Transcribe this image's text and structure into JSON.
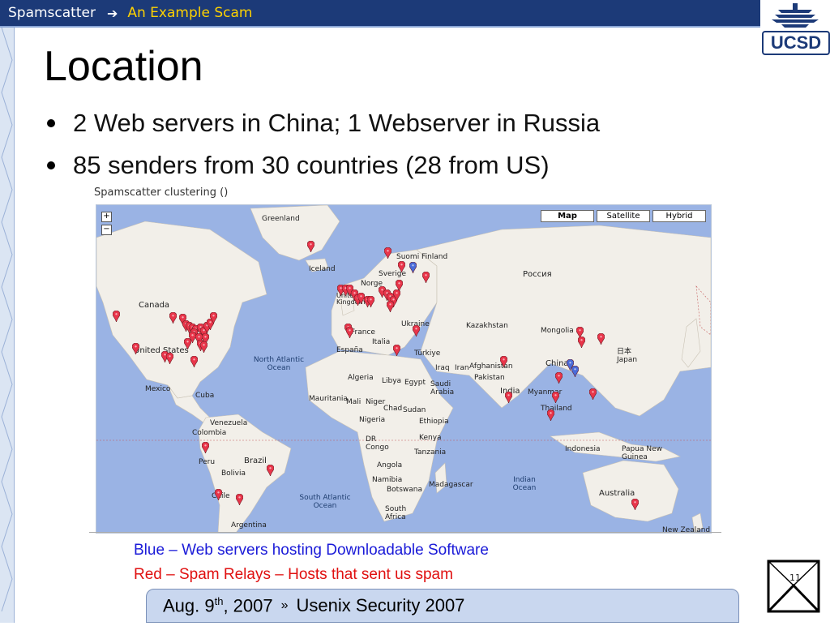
{
  "header": {
    "crumb_1": "Spamscatter",
    "crumb_2": "An Example Scam",
    "logo_text": "UCSD"
  },
  "slide": {
    "title": "Location",
    "bullets": [
      "2 Web servers in China; 1 Webserver in Russia",
      "85 senders from 30 countries (28 from US)"
    ]
  },
  "map": {
    "caption": "Spamscatter clustering ()",
    "type_buttons": [
      "Map",
      "Satellite",
      "Hybrid"
    ],
    "active_type": "Map",
    "zoom_in": "+",
    "zoom_out": "−",
    "labels": {
      "greenland": "Greenland",
      "iceland": "Iceland",
      "suomi": "Suomi Finland",
      "sverige": "Sverige",
      "norge": "Norge",
      "russia": "Россия",
      "canada": "Canada",
      "united_states": "United States",
      "mexico": "Mexico",
      "cuba": "Cuba",
      "venezuela": "Venezuela",
      "colombia": "Colombia",
      "peru": "Peru",
      "bolivia": "Bolivia",
      "brazil": "Brazil",
      "chile": "Chile",
      "argentina": "Argentina",
      "north_atlantic": "North Atlantic Ocean",
      "south_atlantic": "South Atlantic Ocean",
      "indian_ocean": "Indian Ocean",
      "france": "France",
      "espana": "España",
      "italia": "Italia",
      "ukraine": "Ukraine",
      "turkiye": "Türkiye",
      "kazakhstan": "Kazakhstan",
      "mongolia": "Mongolia",
      "china": "China",
      "japan": "日本 Japan",
      "algeria": "Algeria",
      "libya": "Libya",
      "egypt": "Egypt",
      "saudi": "Saudi Arabia",
      "iran": "Iran",
      "iraq": "Iraq",
      "afghanistan": "Afghanistan",
      "pakistan": "Pakistan",
      "india": "India",
      "myanmar": "Myanmar",
      "thailand": "Thailand",
      "mauritania": "Mauritania",
      "mali": "Mali",
      "niger": "Niger",
      "chad": "Chad",
      "sudan": "Sudan",
      "nigeria": "Nigeria",
      "ethiopia": "Ethiopia",
      "kenya": "Kenya",
      "dr_congo": "DR Congo",
      "tanzania": "Tanzania",
      "angola": "Angola",
      "namibia": "Namibia",
      "botswana": "Botswana",
      "south_africa": "South Africa",
      "madagascar": "Madagascar",
      "indonesia": "Indonesia",
      "papua": "Papua New Guinea",
      "australia": "Australia",
      "new_zealand": "New Zealand",
      "united_kingdom": "United Kingdom"
    }
  },
  "legend": {
    "blue": "Blue – Web servers hosting Downloadable Software",
    "red": "Red – Spam Relays – Hosts that sent us spam"
  },
  "footer": {
    "date_main": "Aug. 9",
    "date_sup": "th",
    "date_year": ", 2007",
    "separator": "»",
    "venue": "Usenix Security 2007"
  },
  "slide_number": "11",
  "colors": {
    "header_bg": "#1c3a78",
    "crumb_accent": "#ffd200",
    "ocean": "#9ab3e4",
    "land": "#f2efe9",
    "pin_red": "#e8354a",
    "pin_blue": "#4a6bd8",
    "legend_blue": "#1a1ad8",
    "legend_red": "#e01010"
  }
}
